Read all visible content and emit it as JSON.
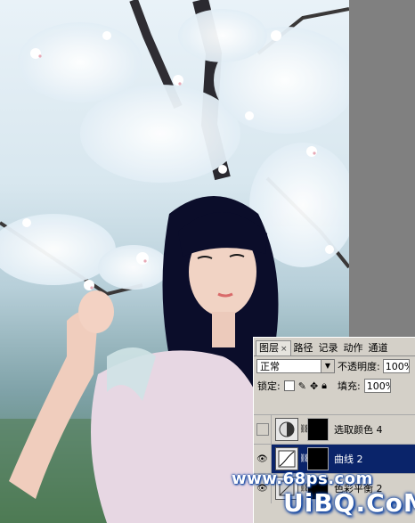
{
  "layers_panel": {
    "tabs": [
      {
        "label": "图层",
        "close": "×"
      },
      {
        "label": "路径"
      },
      {
        "label": "记录"
      },
      {
        "label": "动作"
      },
      {
        "label": "通道"
      }
    ],
    "blend_mode": "正常",
    "opacity_label": "不透明度:",
    "opacity_value": "100%",
    "lock_label": "锁定:",
    "fill_label": "填充:",
    "fill_value": "100%",
    "layers": [
      {
        "name": "选取颜色 4",
        "visible": false,
        "selected": false,
        "icon": "selective-color-icon"
      },
      {
        "name": "曲线 2",
        "visible": true,
        "selected": true,
        "icon": "curves-icon"
      },
      {
        "name": "色彩平衡 2",
        "visible": true,
        "selected": false,
        "icon": "color-balance-icon"
      }
    ]
  },
  "watermark": {
    "line1": "www.68ps.com",
    "line2": "UiBQ.CoM"
  },
  "colors": {
    "panel_bg": "#d4d0c8",
    "selection": "#0a246a",
    "workspace": "#808080"
  }
}
